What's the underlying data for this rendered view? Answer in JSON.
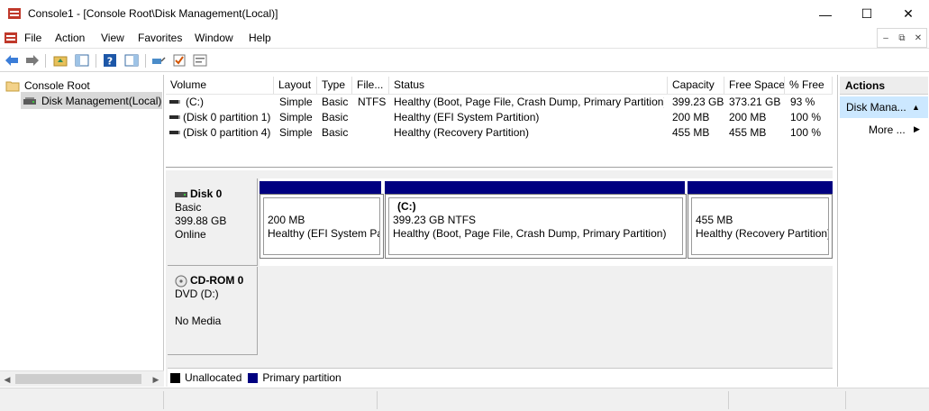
{
  "window": {
    "title": "Console1 - [Console Root\\Disk Management(Local)]"
  },
  "menu": [
    "File",
    "Action",
    "View",
    "Favorites",
    "Window",
    "Help"
  ],
  "tree": {
    "root": "Console Root",
    "child": "Disk Management(Local)"
  },
  "volumes": {
    "headers": [
      "Volume",
      "Layout",
      "Type",
      "File...",
      "Status",
      "Capacity",
      "Free Space",
      "% Free"
    ],
    "rows": [
      [
        "(C:)",
        "Simple",
        "Basic",
        "NTFS",
        "Healthy (Boot, Page File, Crash Dump, Primary Partition)",
        "399.23 GB",
        "373.21 GB",
        "93 %"
      ],
      [
        "(Disk 0 partition 1)",
        "Simple",
        "Basic",
        "",
        "Healthy (EFI System Partition)",
        "200 MB",
        "200 MB",
        "100 %"
      ],
      [
        "(Disk 0 partition 4)",
        "Simple",
        "Basic",
        "",
        "Healthy (Recovery Partition)",
        "455 MB",
        "455 MB",
        "100 %"
      ]
    ]
  },
  "disk0": {
    "name": "Disk 0",
    "type": "Basic",
    "size": "399.88 GB",
    "status": "Online",
    "partitions": [
      {
        "label": "",
        "size": "200 MB",
        "status": "Healthy (EFI System Partition)"
      },
      {
        "label": "(C:)",
        "size": "399.23 GB NTFS",
        "status": "Healthy (Boot, Page File, Crash Dump, Primary Partition)"
      },
      {
        "label": "",
        "size": "455 MB",
        "status": "Healthy (Recovery Partition)"
      }
    ]
  },
  "cdrom": {
    "name": "CD-ROM 0",
    "drive": "DVD (D:)",
    "status": "No Media"
  },
  "legend": {
    "unallocated": "Unallocated",
    "primary": "Primary partition"
  },
  "colors": {
    "primary_partition": "#000080",
    "unallocated": "#000000",
    "selection": "#cce8ff"
  },
  "actions": {
    "header": "Actions",
    "section": "Disk Mana...",
    "more": "More ..."
  }
}
